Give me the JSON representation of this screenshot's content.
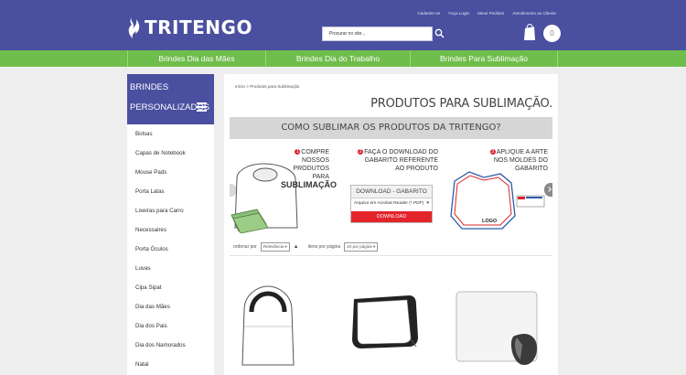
{
  "header": {
    "brand": "TRITENGO",
    "top_links": [
      "Cadastre-se",
      "Faça Login",
      "Meus Pedidos",
      "Atendimento ao Cliente"
    ],
    "search_placeholder": "Procurar no site...",
    "cart_count": "0"
  },
  "nav": [
    "Brindes Dia das Mães",
    "Brindes Dia do Trabalho",
    "Brindes Para Sublimação"
  ],
  "sidebar": {
    "title_line1": "BRINDES",
    "title_line2": "PERSONALIZADOS",
    "items": [
      "Bolsas",
      "Capas de Notebook",
      "Mouse Pads",
      "Porta Latas",
      "Lixeiras para Carro",
      "Necessaires",
      "Porta Óculos",
      "Luvas",
      "Cipa Sipat",
      "Dia das Mães",
      "Dia dos Pais",
      "Dia dos Namorados",
      "Natal"
    ]
  },
  "main": {
    "breadcrumb": "Início  >  Produtos para Sublimação",
    "page_title": "PRODUTOS PARA SUBLIMAÇÃO.",
    "banner_title": "COMO SUBLIMAR OS PRODUTOS DA TRITENGO?",
    "step1": {
      "num": "1",
      "line1": "COMPRE NOSSOS",
      "line2": "PRODUTOS PARA",
      "line3": "SUBLIMAÇÃO"
    },
    "step2": {
      "num": "2",
      "line1": "FAÇA O DOWNLOAD DO",
      "line2": "GABARITO REFERENTE",
      "line3": "AO PRODUTO"
    },
    "step3": {
      "num": "3",
      "line1": "APLIQUE A ARTE",
      "line2": "NOS MOLDES DO GABARITO"
    },
    "download": {
      "title": "DOWNLOAD - GABARITO",
      "select": "Arquivo em Acrobat Reader (*.PDF)",
      "button": "DOWNLOAD"
    },
    "logo_label": "LOGO",
    "sort_label": "ordenar por",
    "sort_value": "Relevância",
    "per_page_label": "itens por página",
    "per_page_value": "24 por página"
  },
  "colors": {
    "header": "#4a4f9f",
    "nav": "#6fbd4a",
    "accent_red": "#e3242b"
  }
}
